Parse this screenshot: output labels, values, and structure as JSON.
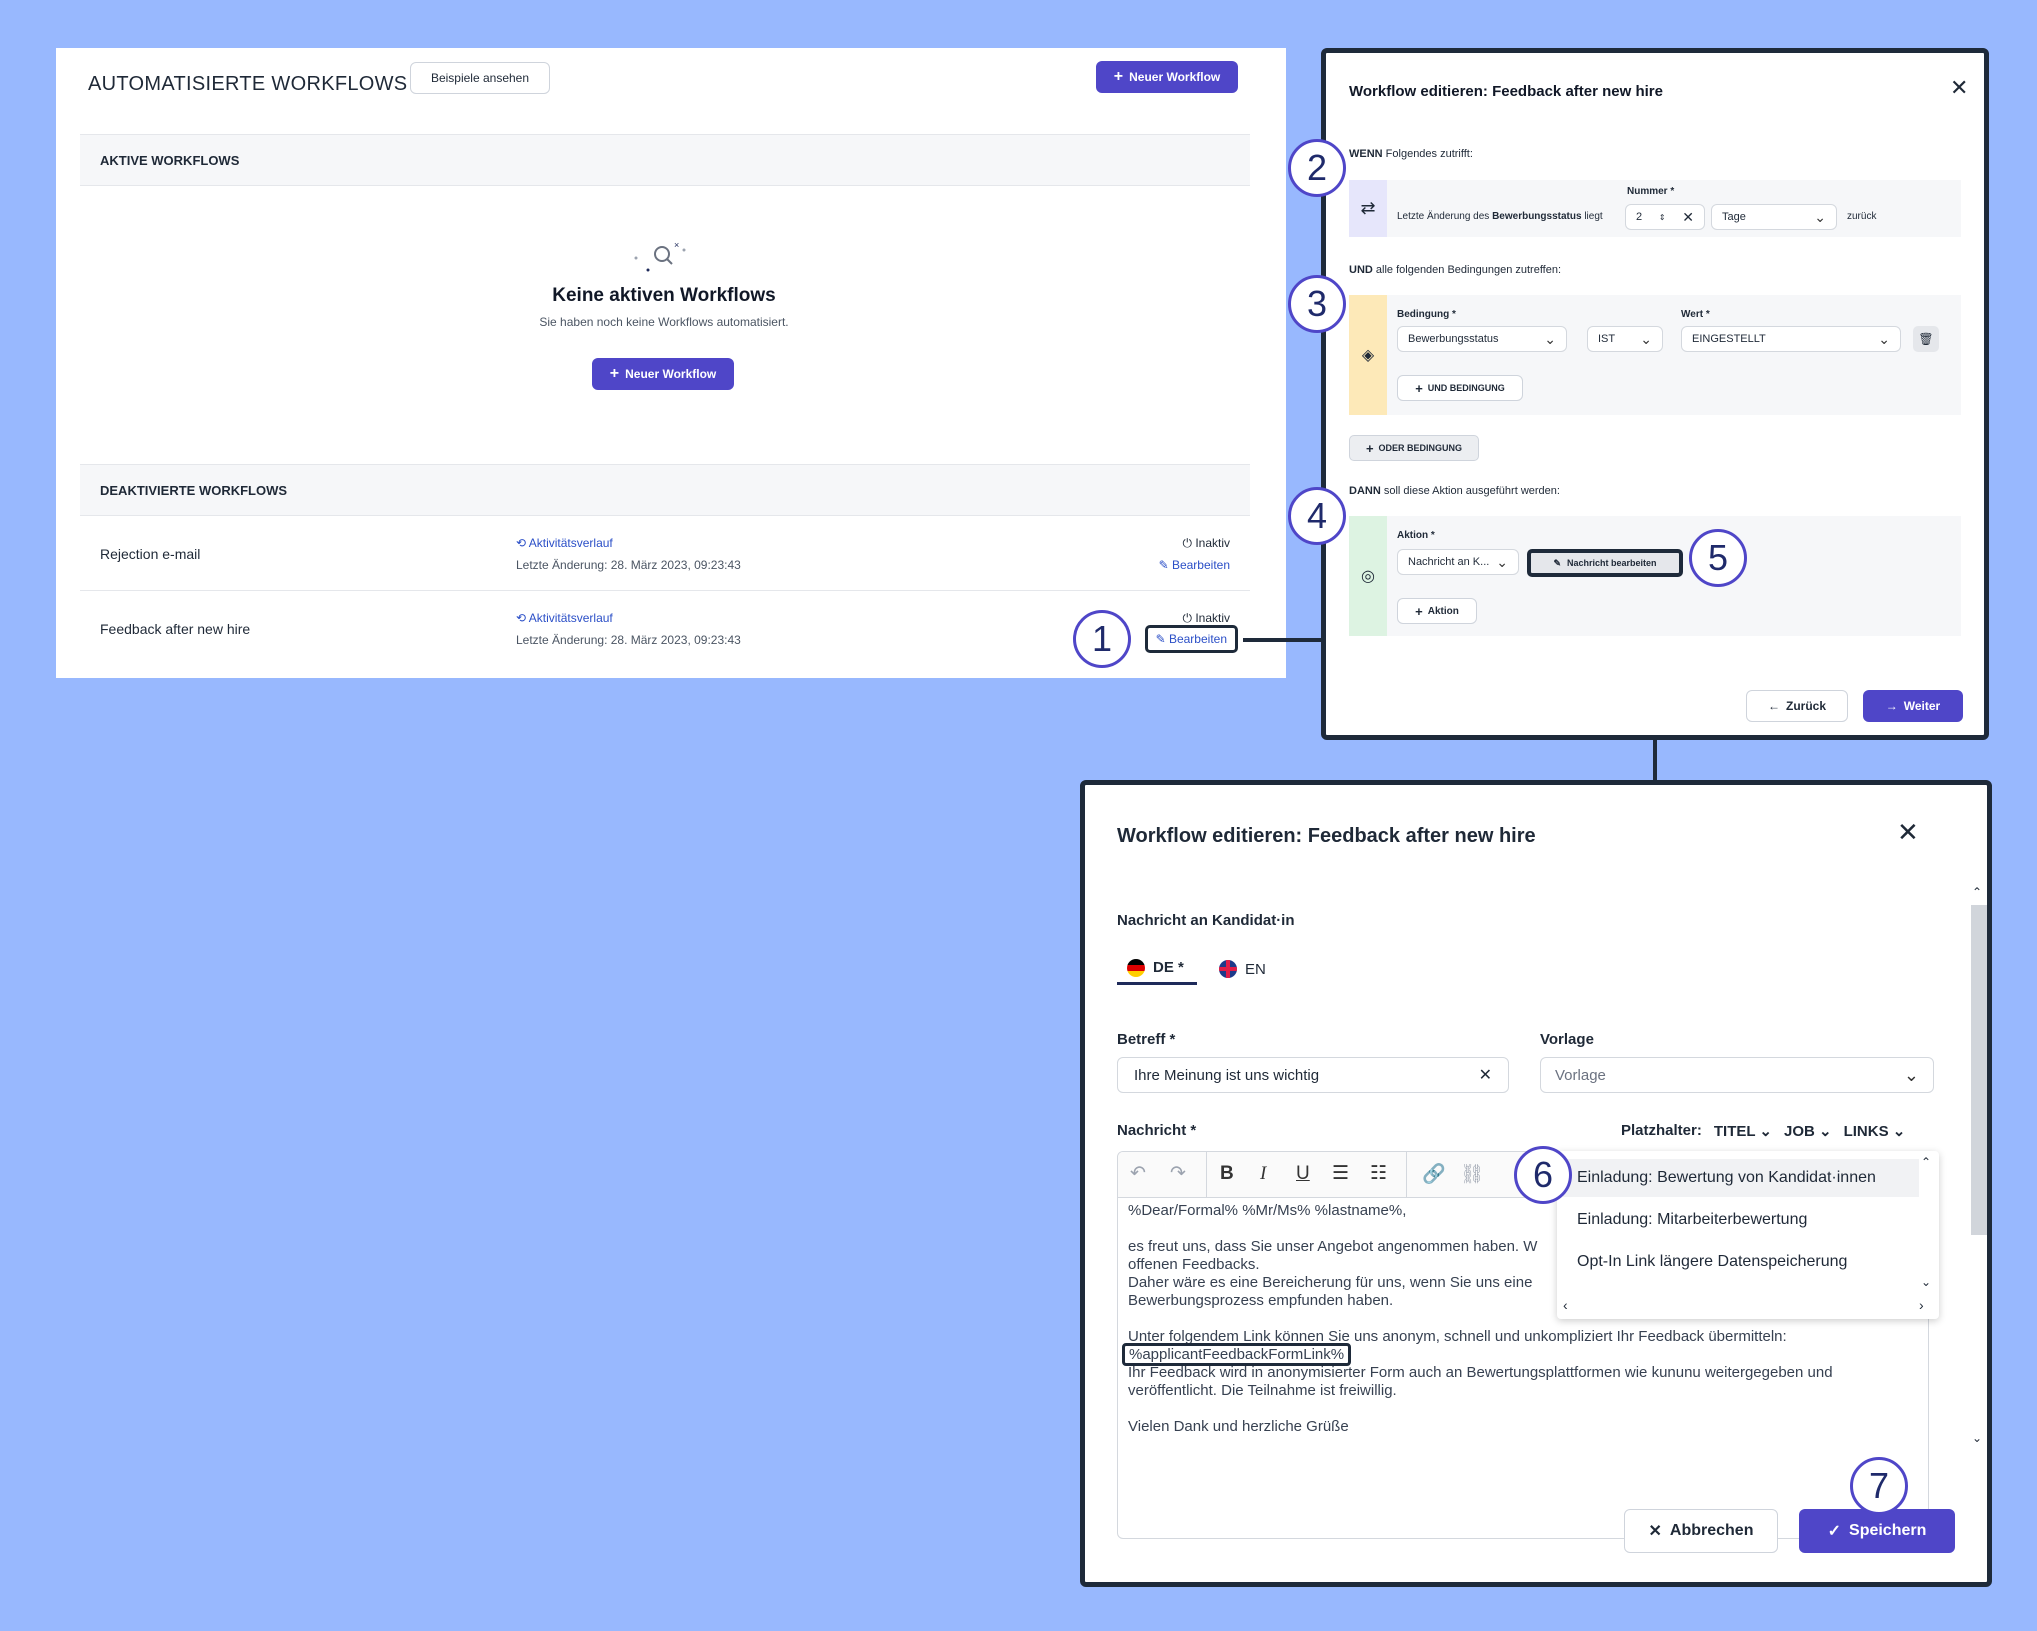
{
  "left": {
    "title": "AUTOMATISIERTE WORKFLOWS",
    "examples_btn": "Beispiele ansehen",
    "new_workflow_btn": "Neuer Workflow",
    "active_header": "AKTIVE WORKFLOWS",
    "empty_title": "Keine aktiven Workflows",
    "empty_sub": "Sie haben noch keine Workflows automatisiert.",
    "empty_btn": "Neuer Workflow",
    "deactivated_header": "DEAKTIVIERTE WORKFLOWS",
    "rows": [
      {
        "name": "Rejection e-mail",
        "activity": "Aktivitätsverlauf",
        "changed": "Letzte Änderung: 28. März 2023, 09:23:43",
        "status": "Inaktiv",
        "edit": "Bearbeiten"
      },
      {
        "name": "Feedback after new hire",
        "activity": "Aktivitätsverlauf",
        "changed": "Letzte Änderung: 28. März 2023, 09:23:43",
        "status": "Inaktiv",
        "edit": "Bearbeiten"
      }
    ]
  },
  "dialog1": {
    "title": "Workflow editieren: Feedback after new hire",
    "when_bold": "WENN",
    "when_rest": "Folgendes zutrifft:",
    "number_label": "Nummer *",
    "last_change_pre": "Letzte Änderung des",
    "last_change_bold": "Bewerbungsstatus",
    "last_change_post": "liegt",
    "number_value": "2",
    "unit_value": "Tage",
    "back_word": "zurück",
    "and_bold": "UND",
    "and_rest": "alle folgenden Bedingungen zutreffen:",
    "cond_label": "Bedingung *",
    "cond_value": "Bewerbungsstatus",
    "op_value": "IST",
    "value_label": "Wert *",
    "value_value": "EINGESTELLT",
    "add_and": "UND BEDINGUNG",
    "add_or": "ODER BEDINGUNG",
    "then_bold": "DANN",
    "then_rest": "soll diese Aktion ausgeführt werden:",
    "action_label": "Aktion *",
    "action_value": "Nachricht an K...",
    "edit_msg_btn": "Nachricht bearbeiten",
    "add_action": "Aktion",
    "back_btn": "Zurück",
    "next_btn": "Weiter"
  },
  "dialog2": {
    "title": "Workflow editieren: Feedback after new hire",
    "section": "Nachricht an Kandidat·in",
    "tab_de": "DE *",
    "tab_en": "EN",
    "subject_label": "Betreff *",
    "subject_value": "Ihre Meinung ist uns wichtig",
    "template_label": "Vorlage",
    "template_placeholder": "Vorlage",
    "message_label": "Nachricht *",
    "placeholder_label": "Platzhalter:",
    "ph_titel": "TITEL",
    "ph_job": "JOB",
    "ph_links": "LINKS",
    "dropdown_items": [
      "Einladung: Bewertung von Kandidat·innen",
      "Einladung: Mitarbeiterbewertung",
      "Opt-In Link längere Datenspeicherung"
    ],
    "body_lines": [
      "%Dear/Formal% %Mr/Ms% %lastname%,",
      "es freut uns, dass Sie unser Angebot angenommen haben. W",
      "offenen Feedbacks.",
      "Daher wäre es eine Bereicherung für uns, wenn Sie uns eine",
      "Bewerbungsprozess empfunden haben.",
      "Unter folgendem Link können Sie uns anonym, schnell und unkompliziert Ihr Feedback übermitteln:",
      "%applicantFeedbackFormLink%",
      "Ihr Feedback wird in anonymisierter Form auch an Bewertungsplattformen wie kununu weitergegeben und",
      "veröffentlicht. Die Teilnahme ist freiwillig.",
      "Vielen Dank und herzliche Grüße"
    ],
    "cancel_btn": "Abbrechen",
    "save_btn": "Speichern"
  },
  "callouts": [
    "1",
    "2",
    "3",
    "4",
    "5",
    "6",
    "7"
  ]
}
